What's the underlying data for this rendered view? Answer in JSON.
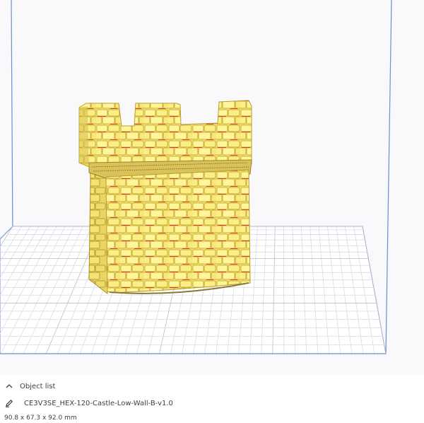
{
  "object_list": {
    "toggle_label": "Object list",
    "toggle_icon": "chevron-up-icon"
  },
  "object": {
    "edit_icon": "pencil-icon",
    "name": "CE3V3SE_HEX-120-Castle-Low-Wall-B-v1.0",
    "dimensions": "90.8 x 67.3 x 92.0 mm"
  },
  "colors": {
    "build_volume_edge": "#6a8fcf",
    "build_plate": "#ffffff",
    "grid_minor": "#d8dbe2",
    "grid_major": "#b9bdc8",
    "model_fill": "#f5e47a",
    "model_highlight": "#fff59a",
    "model_shadow": "#c9b23a",
    "overhang": "#d9322a"
  }
}
